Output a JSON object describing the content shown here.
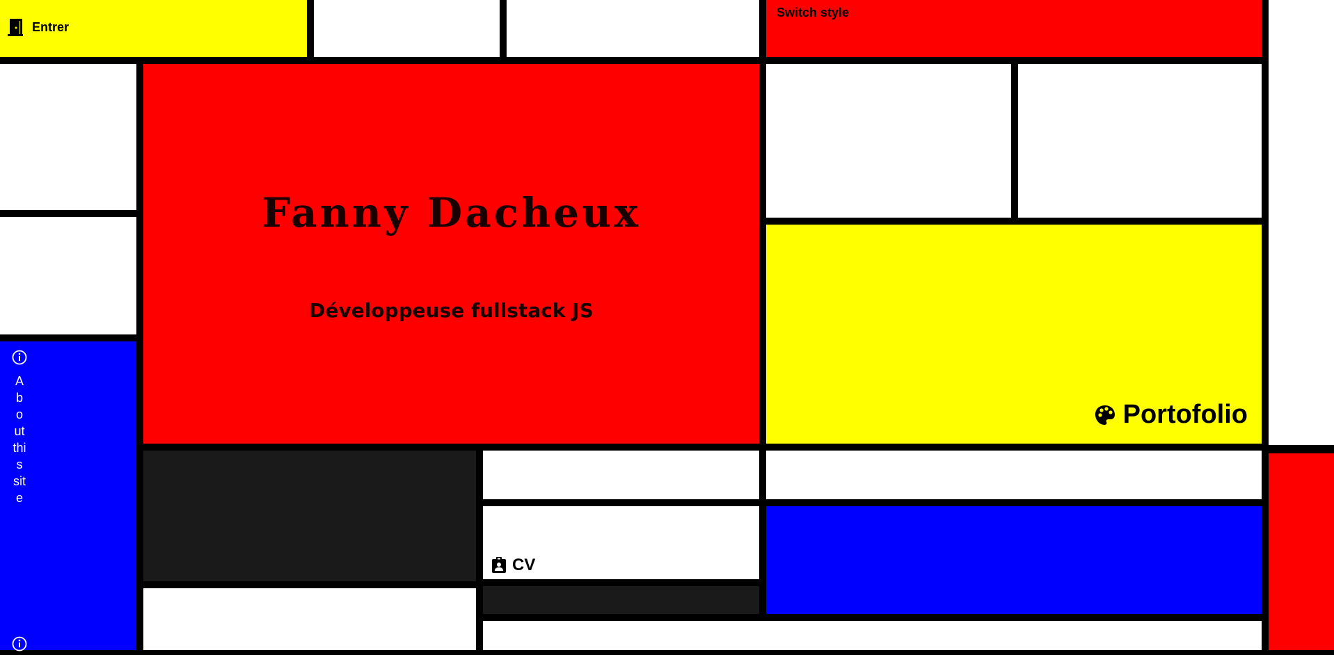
{
  "nav": {
    "enter_label": "Entrer",
    "enter_icon": "door-open-icon",
    "switch_style_label": "Switch style"
  },
  "hero": {
    "name": "Fanny Dacheux",
    "subtitle": "Développeuse fullstack JS"
  },
  "links": {
    "portfolio_label": "Portofolio",
    "portfolio_icon": "palette-icon",
    "cv_label": "CV",
    "cv_icon": "id-badge-icon",
    "about_label": "About this site",
    "about_icon": "info-circle-icon"
  },
  "colors": {
    "red": "#ff0000",
    "yellow": "#ffff00",
    "blue": "#0000ff",
    "black": "#000000",
    "dark": "#1a1a1a",
    "white": "#ffffff"
  }
}
